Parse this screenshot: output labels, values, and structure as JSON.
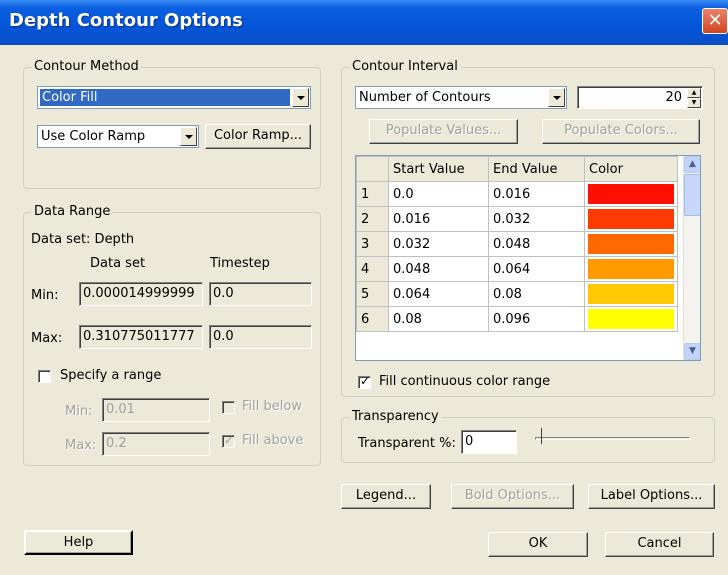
{
  "window": {
    "title": "Depth Contour Options",
    "close_glyph": "✕"
  },
  "contour_method": {
    "group_title": "Contour Method",
    "method_value": "Color Fill",
    "ramp_value": "Use Color Ramp",
    "color_ramp_button": "Color Ramp..."
  },
  "data_range": {
    "group_title": "Data Range",
    "dataset_label": "Data set:  Depth",
    "col_dataset": "Data set",
    "col_timestep": "Timestep",
    "min_label": "Min:",
    "max_label": "Max:",
    "min_dataset": "0.000014999999",
    "min_timestep": "0.0",
    "max_dataset": "0.310775011777",
    "max_timestep": "0.0",
    "specify_range_label": "Specify a range",
    "specify_min_label": "Min:",
    "specify_min_value": "0.01",
    "specify_max_label": "Max:",
    "specify_max_value": "0.2",
    "fill_below_label": "Fill below",
    "fill_above_label": "Fill above"
  },
  "contour_interval": {
    "group_title": "Contour Interval",
    "mode_value": "Number of Contours",
    "count_value": "20",
    "populate_values_button": "Populate Values...",
    "populate_colors_button": "Populate Colors...",
    "columns": [
      "Start Value",
      "End Value",
      "Color"
    ],
    "rows": [
      {
        "n": "1",
        "start": "0.0",
        "end": "0.016",
        "color": "#ff1000"
      },
      {
        "n": "2",
        "start": "0.016",
        "end": "0.032",
        "color": "#ff3a00"
      },
      {
        "n": "3",
        "start": "0.032",
        "end": "0.048",
        "color": "#ff6a00"
      },
      {
        "n": "4",
        "start": "0.048",
        "end": "0.064",
        "color": "#ff9a00"
      },
      {
        "n": "5",
        "start": "0.064",
        "end": "0.08",
        "color": "#ffc800"
      },
      {
        "n": "6",
        "start": "0.08",
        "end": "0.096",
        "color": "#ffff00"
      }
    ],
    "fill_continuous_label": "Fill continuous color range"
  },
  "transparency": {
    "group_title": "Transparency",
    "label": "Transparent %:",
    "value": "0",
    "slider_level": 0
  },
  "buttons": {
    "legend": "Legend...",
    "bold_options": "Bold Options...",
    "label_options": "Label Options...",
    "help": "Help",
    "ok": "OK",
    "cancel": "Cancel"
  },
  "colors": {
    "title_bar": "#0554d8",
    "selection": "#316ac5",
    "dialog_bg": "#ece9d8"
  },
  "icons": [
    "close-icon",
    "dropdown-arrow-icon",
    "scroll-up-icon",
    "scroll-down-icon",
    "spin-up-icon",
    "spin-down-icon"
  ]
}
